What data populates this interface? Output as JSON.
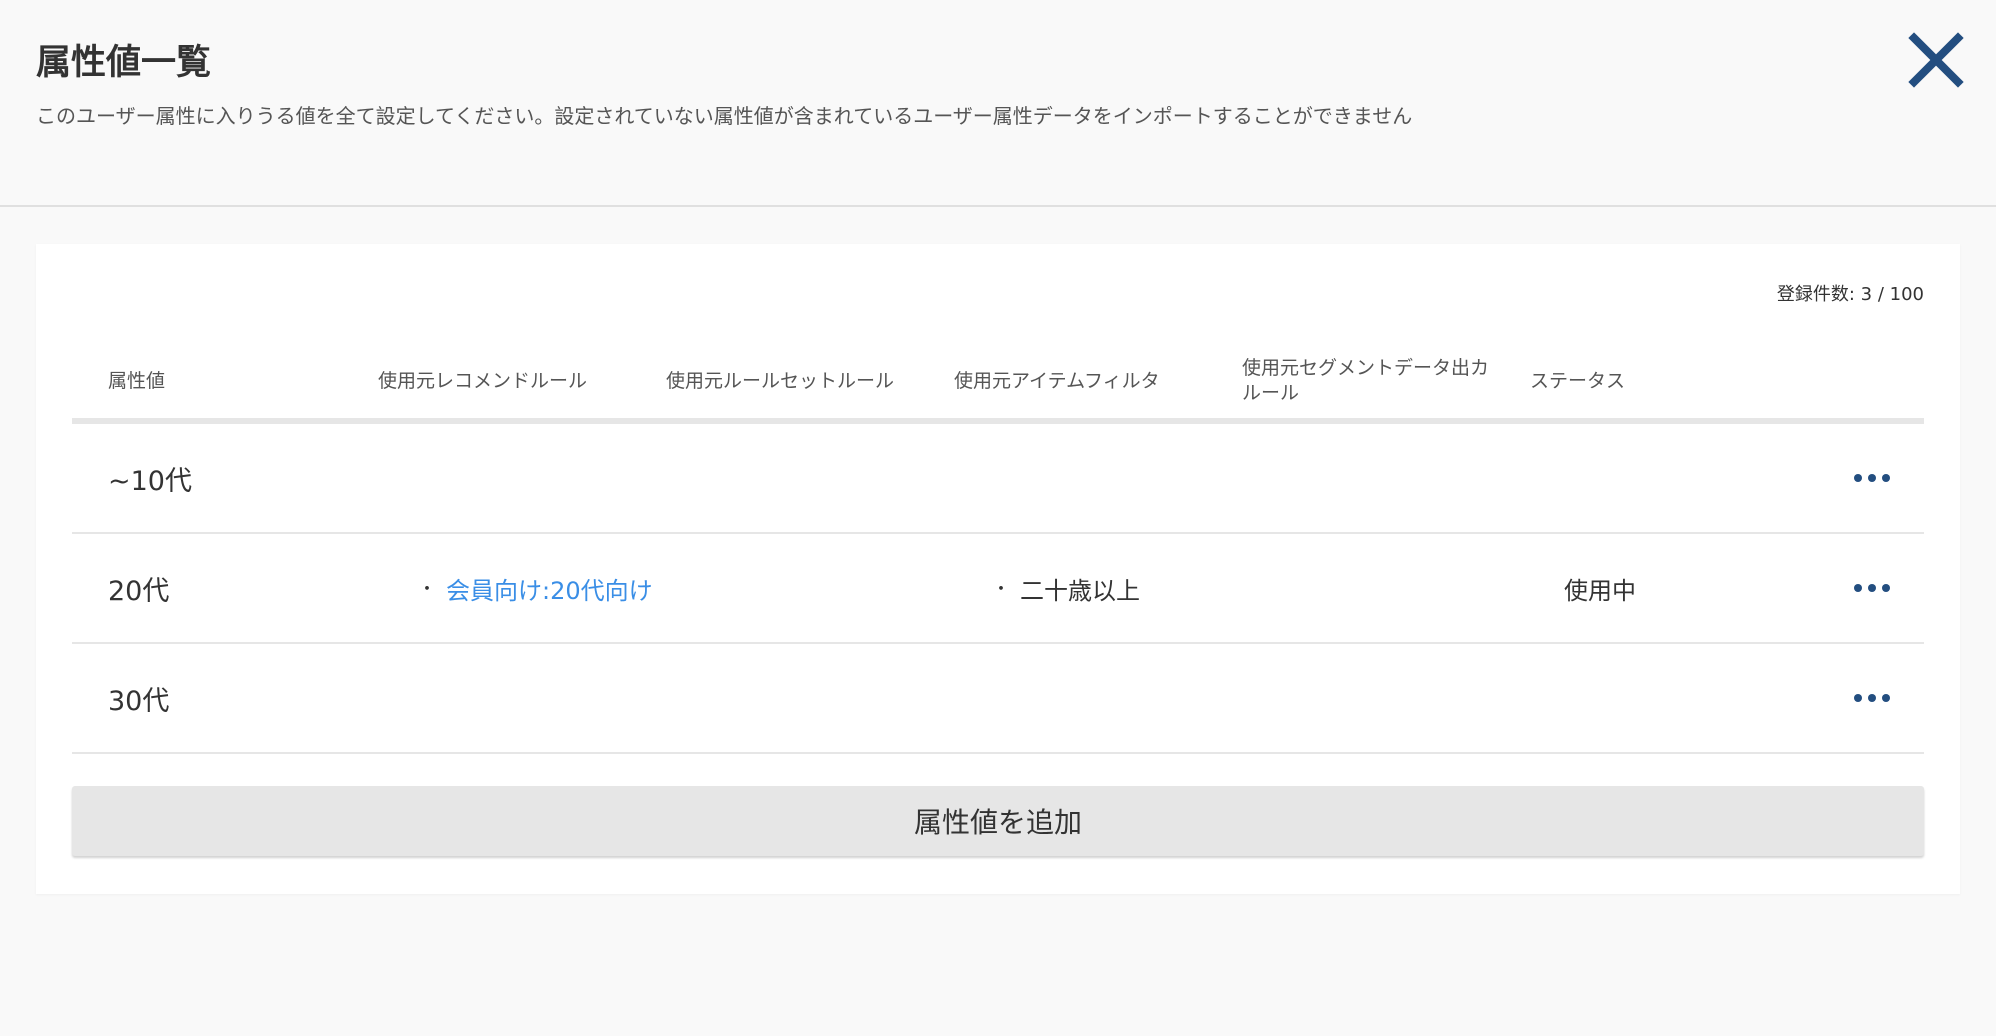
{
  "header": {
    "title": "属性値一覧",
    "description": "このユーザー属性に入りうる値を全て設定してください。設定されていない属性値が含まれているユーザー属性データをインポートすることができません",
    "close_icon": "close-x-icon"
  },
  "colors": {
    "accent_dark": "#234e80",
    "link": "#3a8ee6",
    "add_button_bg": "#e6e6e6"
  },
  "table": {
    "count_label": "登録件数: 3 / 100",
    "columns": {
      "value": "属性値",
      "recommend_rule": "使用元レコメンドルール",
      "ruleset_rule": "使用元ルールセットルール",
      "item_filter": "使用元アイテムフィルタ",
      "segment_rule": "使用元セグメントデータ出カルール",
      "status": "ステータス"
    },
    "rows": [
      {
        "value": "~10代",
        "recommend_rule": "",
        "ruleset_rule": "",
        "item_filter": "",
        "segment_rule": "",
        "status": ""
      },
      {
        "value": "20代",
        "recommend_rule": "会員向け:20代向け",
        "ruleset_rule": "",
        "item_filter": "二十歳以上",
        "segment_rule": "",
        "status": "使用中"
      },
      {
        "value": "30代",
        "recommend_rule": "",
        "ruleset_rule": "",
        "item_filter": "",
        "segment_rule": "",
        "status": ""
      }
    ],
    "bullet": "・",
    "more_icon": "more-horizontal-icon"
  },
  "add_button": {
    "label": "属性値を追加"
  }
}
